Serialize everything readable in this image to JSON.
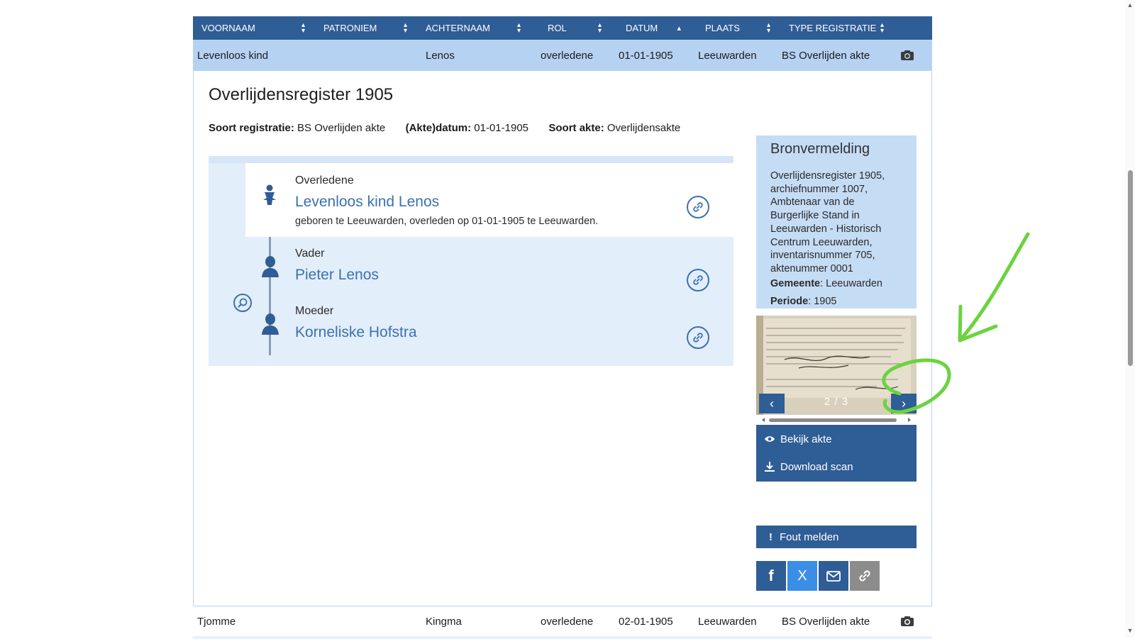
{
  "table": {
    "headers": [
      "VOORNAAM",
      "PATRONIEM",
      "ACHTERNAAM",
      "ROL",
      "DATUM",
      "PLAATS",
      "TYPE REGISTRATIE"
    ],
    "active_row": {
      "voornaam": "Levenloos kind",
      "patroniem": "",
      "achternaam": "Lenos",
      "rol": "overledene",
      "datum": "01-01-1905",
      "plaats": "Leeuwarden",
      "type": "BS Overlijden akte"
    },
    "next_row": {
      "voornaam": "Tjomme",
      "patroniem": "",
      "achternaam": "Kingma",
      "rol": "overledene",
      "datum": "02-01-1905",
      "plaats": "Leeuwarden",
      "type": "BS Overlijden akte"
    }
  },
  "detail": {
    "title": "Overlijdensregister 1905",
    "meta": {
      "soort_label": "Soort registratie:",
      "soort_value": "BS Overlijden akte",
      "datum_label": "(Akte)datum:",
      "datum_value": "01-01-1905",
      "akte_label": "Soort akte:",
      "akte_value": "Overlijdensakte"
    },
    "persons": [
      {
        "role": "Overledene",
        "name": "Levenloos kind Lenos",
        "desc": "geboren te Leeuwarden, overleden op 01-01-1905 te Leeuwarden."
      },
      {
        "role": "Vader",
        "name": "Pieter Lenos"
      },
      {
        "role": "Moeder",
        "name": "Korneliske Hofstra"
      }
    ]
  },
  "bron": {
    "title": "Bronvermelding",
    "text_lines": [
      "Overlijdensregister 1905,",
      "archiefnummer 1007,",
      "Ambtenaar van de",
      "Burgerlijke Stand in",
      "Leeuwarden - Historisch",
      "Centrum Leeuwarden,",
      "inventarisnummer 705,",
      "aktenummer 0001"
    ],
    "gemeente_label": "Gemeente",
    "gemeente_value": ": Leeuwarden",
    "periode_label": "Periode",
    "periode_value": ": 1905"
  },
  "scan": {
    "counter": "2 / 3",
    "prev_icon": "chevron-left-icon",
    "next_icon": "chevron-right-icon"
  },
  "actions": {
    "view": "Bekijk akte",
    "download": "Download scan",
    "report": "Fout melden"
  },
  "share": {
    "facebook": "f",
    "x": "X",
    "mail": "mail-icon",
    "link": "link-icon"
  },
  "colors": {
    "header_blue": "#2f5d95",
    "row_highlight": "#b6d2f3",
    "link_blue": "#3b71ae",
    "annotation_green": "#6bd33f",
    "facebook": "#2f5d95",
    "x_blue": "#3a8ee6",
    "link_grey": "#8c8c8c"
  }
}
